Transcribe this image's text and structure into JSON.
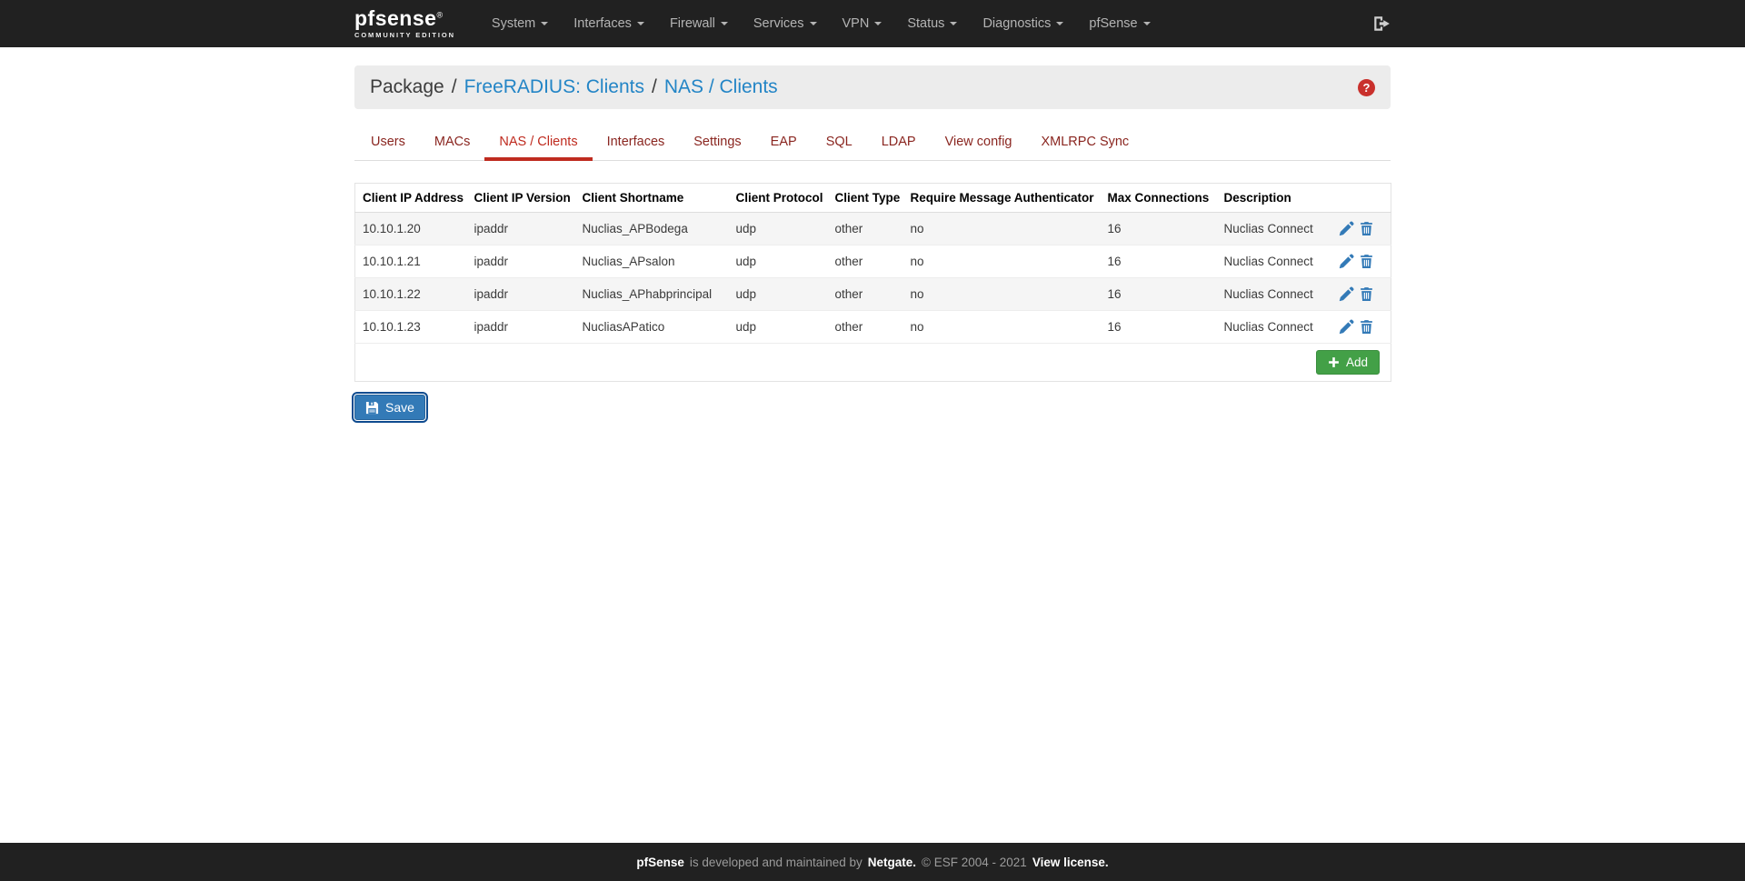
{
  "navbar": {
    "logo": {
      "brand": "pfsense",
      "registered": "®",
      "edition": "COMMUNITY EDITION"
    },
    "items": [
      {
        "label": "System"
      },
      {
        "label": "Interfaces"
      },
      {
        "label": "Firewall"
      },
      {
        "label": "Services"
      },
      {
        "label": "VPN"
      },
      {
        "label": "Status"
      },
      {
        "label": "Diagnostics"
      },
      {
        "label": "pfSense"
      }
    ]
  },
  "breadcrumb": {
    "root": "Package",
    "separator": "/",
    "links": [
      {
        "label": "FreeRADIUS: Clients"
      },
      {
        "label": "NAS / Clients"
      }
    ],
    "help": "?"
  },
  "tabs": [
    {
      "label": "Users",
      "active": false
    },
    {
      "label": "MACs",
      "active": false
    },
    {
      "label": "NAS / Clients",
      "active": true
    },
    {
      "label": "Interfaces",
      "active": false
    },
    {
      "label": "Settings",
      "active": false
    },
    {
      "label": "EAP",
      "active": false
    },
    {
      "label": "SQL",
      "active": false
    },
    {
      "label": "LDAP",
      "active": false
    },
    {
      "label": "View config",
      "active": false
    },
    {
      "label": "XMLRPC Sync",
      "active": false
    }
  ],
  "table": {
    "headers": [
      "Client IP Address",
      "Client IP Version",
      "Client Shortname",
      "Client Protocol",
      "Client Type",
      "Require Message Authenticator",
      "Max Connections",
      "Description"
    ],
    "rows": [
      {
        "ip": "10.10.1.20",
        "version": "ipaddr",
        "shortname": "Nuclias_APBodega",
        "protocol": "udp",
        "type": "other",
        "require_message_authenticator": "no",
        "max_connections": "16",
        "description": "Nuclias Connect"
      },
      {
        "ip": "10.10.1.21",
        "version": "ipaddr",
        "shortname": "Nuclias_APsalon",
        "protocol": "udp",
        "type": "other",
        "require_message_authenticator": "no",
        "max_connections": "16",
        "description": "Nuclias Connect"
      },
      {
        "ip": "10.10.1.22",
        "version": "ipaddr",
        "shortname": "Nuclias_APhabprincipal",
        "protocol": "udp",
        "type": "other",
        "require_message_authenticator": "no",
        "max_connections": "16",
        "description": "Nuclias Connect"
      },
      {
        "ip": "10.10.1.23",
        "version": "ipaddr",
        "shortname": "NucliasAPatico",
        "protocol": "udp",
        "type": "other",
        "require_message_authenticator": "no",
        "max_connections": "16",
        "description": "Nuclias Connect"
      }
    ],
    "add_button": "Add"
  },
  "save_button": "Save",
  "footer": {
    "brand": "pfSense",
    "maintained": "is developed and maintained by",
    "netgate": "Netgate.",
    "copyright": "© ESF 2004 - 2021",
    "license": "View license."
  },
  "colors": {
    "navbar_bg": "#212121",
    "breadcrumb_bg": "#ececec",
    "link_blue": "#2385c6",
    "tab_red_active": "#bf2b1f",
    "tab_red_inactive": "#8a2620",
    "icon_blue": "#337ab7",
    "add_green": "#43a047",
    "save_blue": "#337ab7",
    "help_red": "#c9302c",
    "row_stripe": "#f5f5f5"
  }
}
